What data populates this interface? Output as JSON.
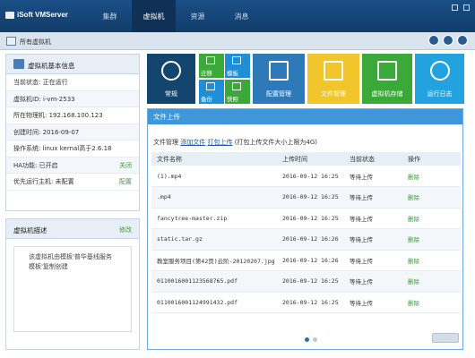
{
  "app": {
    "title": "iSoft VMServer"
  },
  "nav": {
    "tabs": [
      "集群",
      "虚拟机",
      "资源",
      "消息"
    ],
    "active": 1
  },
  "subbar": {
    "label": "所有虚拟机"
  },
  "info_panel": {
    "title": "虚拟机基本信息",
    "rows": [
      {
        "text": "当前状态: 正在运行",
        "link": ""
      },
      {
        "text": "虚拟机ID: i-vm-2533",
        "link": ""
      },
      {
        "text": "所在物理机: 192.168.100.123",
        "link": ""
      },
      {
        "text": "创建时间: 2016-09-07",
        "link": ""
      },
      {
        "text": "操作系统: linux kernal高于2.6.18",
        "link": ""
      },
      {
        "text": "HA功能: 已开启",
        "link": "关闭"
      },
      {
        "text": "优先运行主机: 未配置",
        "link": "配置"
      }
    ]
  },
  "desc_panel": {
    "title": "虚拟机描述",
    "edit": "修改",
    "text": "该虚拟机由模板'普华基线服务模板'复制创建"
  },
  "tiles": {
    "normal": "常规",
    "migrate": "迁移",
    "template": "模板",
    "backup": "备份",
    "snapshot": "快照",
    "config": "配置管理",
    "files": "文件管理",
    "storage": "虚拟机存储",
    "log": "运行日志"
  },
  "upload": {
    "header": "文件上传",
    "tools_prefix": "文件管理",
    "add_file": "添加文件",
    "pack_upload": "打包上传",
    "note": "(打包上传文件大小上限为4G)",
    "columns": [
      "文件名称",
      "上传时间",
      "当前状态",
      "操作"
    ],
    "rows": [
      {
        "name": "(1).mp4",
        "time": "2016-09-12 16:25",
        "status": "等待上传",
        "op": "删除"
      },
      {
        "name": ".mp4",
        "time": "2016-09-12 16:25",
        "status": "等待上传",
        "op": "删除"
      },
      {
        "name": "fancytree-master.zip",
        "time": "2016-09-12 16:25",
        "status": "等待上传",
        "op": "删除"
      },
      {
        "name": "static.tar.gz",
        "time": "2016-09-12 16:26",
        "status": "等待上传",
        "op": "删除"
      },
      {
        "name": "教室服务项目(第42页)云阶-20120207.jpg",
        "time": "2016-09-12 16:26",
        "status": "等待上传",
        "op": "删除"
      },
      {
        "name": "0110016001123568765.pdf",
        "time": "2016-09-12 16:25",
        "status": "等待上传",
        "op": "删除"
      },
      {
        "name": "0110016001124991432.pdf",
        "time": "2016-09-12 16:25",
        "status": "等待上传",
        "op": "删除"
      }
    ]
  },
  "colors": {
    "accent": "#3d97d8",
    "nav": "#1a4f86",
    "tile_dark": "#13456f",
    "tile_green": "#3aa93a",
    "tile_teal": "#1e8fd6",
    "tile_yellow": "#f0c62c",
    "tile_purple": "#2e7ab8",
    "tile_cyan": "#22a3e0",
    "link_green": "#3c9b3c"
  }
}
